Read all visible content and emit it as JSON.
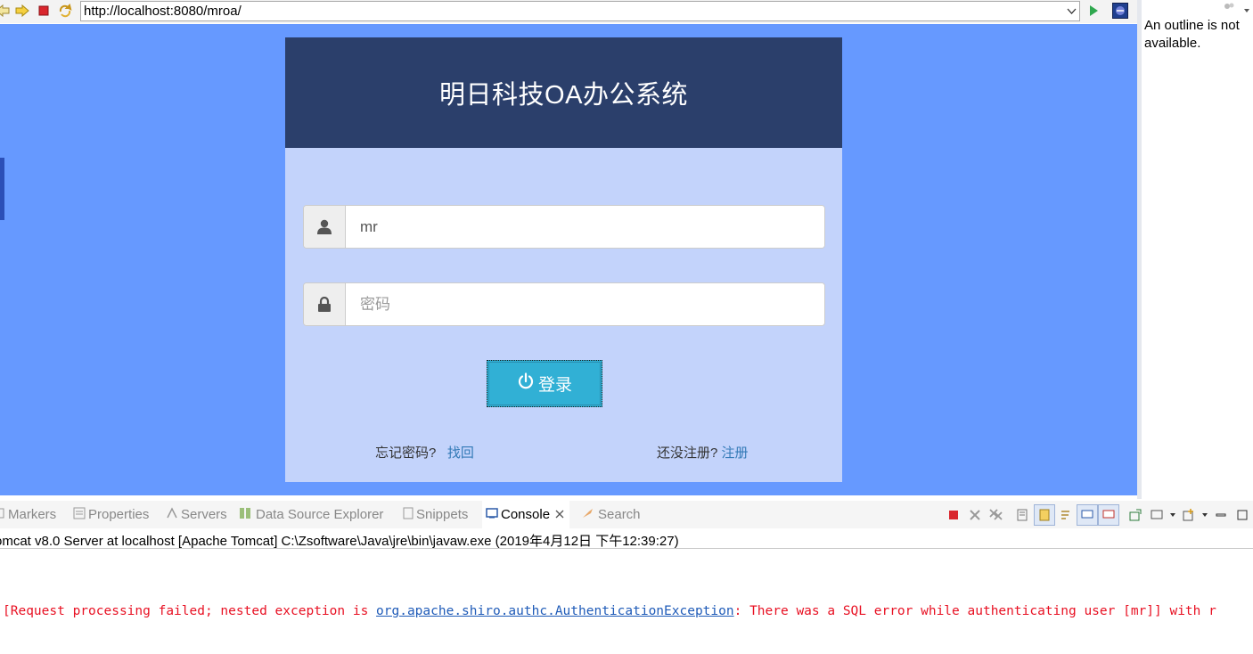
{
  "browser": {
    "url": "http://localhost:8080/mroa/"
  },
  "outline": {
    "message": "An outline is not available."
  },
  "login": {
    "title": "明日科技OA办公系统",
    "username_value": "mr",
    "password_placeholder": "密码",
    "login_label": "登录",
    "forgot_text": "忘记密码?",
    "forgot_link": "找回",
    "register_text": "还没注册?",
    "register_link": "注册"
  },
  "console": {
    "tabs": [
      {
        "label": "Markers",
        "icon": "markers-icon"
      },
      {
        "label": "Properties",
        "icon": "properties-icon"
      },
      {
        "label": "Servers",
        "icon": "servers-icon"
      },
      {
        "label": "Data Source Explorer",
        "icon": "data-source-icon"
      },
      {
        "label": "Snippets",
        "icon": "snippets-icon"
      },
      {
        "label": "Console",
        "icon": "console-icon"
      },
      {
        "label": "Search",
        "icon": "search-icon"
      }
    ],
    "info": "omcat v8.0 Server at localhost [Apache Tomcat] C:\\Zsoftware\\Java\\jre\\bin\\javaw.exe (2019年4月12日 下午12:39:27)",
    "error_prefix": "[Request processing failed; nested exception is ",
    "error_link": "org.apache.shiro.authc.AuthenticationException",
    "error_suffix": ": There was a SQL error while authenticating user [mr]] with r"
  },
  "colors": {
    "page_background": "#6699ff",
    "header_background": "#2b3f6b",
    "card_background": "#c3d3fb",
    "button_background": "#31b0d5",
    "error_text": "#e81123"
  }
}
